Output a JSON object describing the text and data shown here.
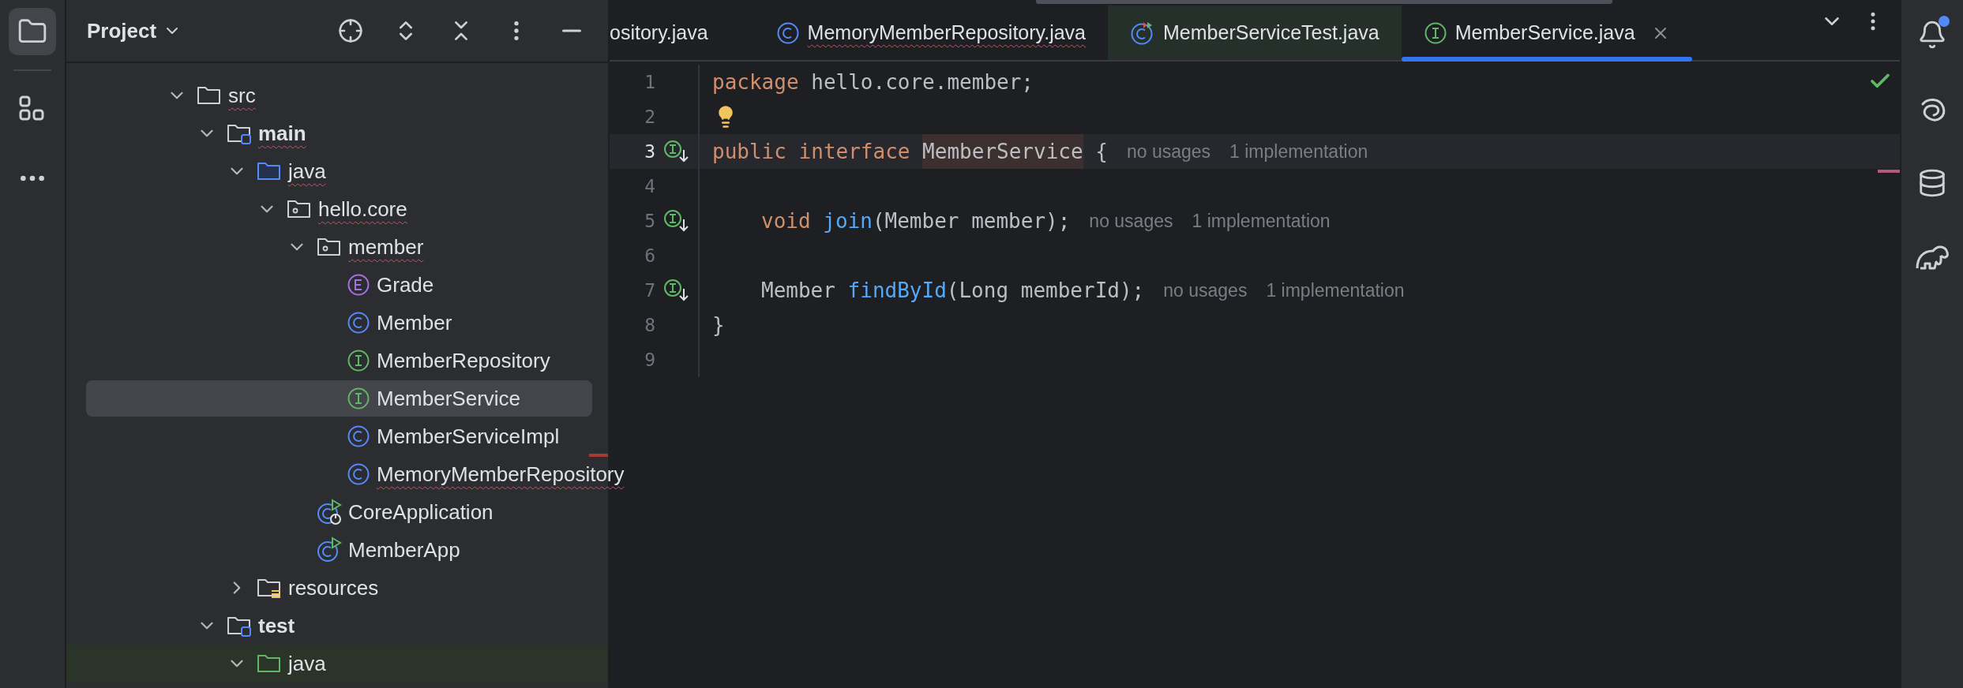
{
  "project_panel": {
    "title": "Project",
    "tree": [
      {
        "label": "src",
        "kind": "folder",
        "expanded": true,
        "error": true,
        "bold": false,
        "selected": false,
        "highlighted": false,
        "children": [
          {
            "label": "main",
            "kind": "source-root",
            "expanded": true,
            "error": true,
            "bold": true,
            "selected": false,
            "highlighted": false,
            "children": [
              {
                "label": "java",
                "kind": "source-folder",
                "expanded": true,
                "error": true,
                "bold": false,
                "selected": false,
                "highlighted": false,
                "children": [
                  {
                    "label": "hello.core",
                    "kind": "package",
                    "expanded": true,
                    "error": true,
                    "bold": false,
                    "selected": false,
                    "highlighted": false,
                    "children": [
                      {
                        "label": "member",
                        "kind": "package",
                        "expanded": true,
                        "error": true,
                        "bold": false,
                        "selected": false,
                        "highlighted": false,
                        "children": [
                          {
                            "label": "Grade",
                            "kind": "enum",
                            "error": false,
                            "bold": false,
                            "selected": false,
                            "highlighted": false
                          },
                          {
                            "label": "Member",
                            "kind": "class",
                            "error": false,
                            "bold": false,
                            "selected": false,
                            "highlighted": false
                          },
                          {
                            "label": "MemberRepository",
                            "kind": "interface",
                            "error": false,
                            "bold": false,
                            "selected": false,
                            "highlighted": false
                          },
                          {
                            "label": "MemberService",
                            "kind": "interface",
                            "error": false,
                            "bold": false,
                            "selected": true,
                            "highlighted": false
                          },
                          {
                            "label": "MemberServiceImpl",
                            "kind": "class",
                            "error": false,
                            "bold": false,
                            "selected": false,
                            "highlighted": false
                          },
                          {
                            "label": "MemoryMemberRepository",
                            "kind": "class",
                            "error": true,
                            "bold": false,
                            "selected": false,
                            "highlighted": false
                          }
                        ]
                      },
                      {
                        "label": "CoreApplication",
                        "kind": "spring-app",
                        "error": false,
                        "bold": false,
                        "selected": false,
                        "highlighted": false
                      },
                      {
                        "label": "MemberApp",
                        "kind": "app",
                        "error": false,
                        "bold": false,
                        "selected": false,
                        "highlighted": false
                      }
                    ]
                  }
                ]
              },
              {
                "label": "resources",
                "kind": "resources",
                "expanded": false,
                "error": false,
                "bold": false,
                "selected": false,
                "highlighted": false
              }
            ]
          },
          {
            "label": "test",
            "kind": "source-root",
            "expanded": true,
            "error": false,
            "bold": true,
            "selected": false,
            "highlighted": false,
            "children": [
              {
                "label": "java",
                "kind": "test-folder",
                "expanded": true,
                "error": false,
                "bold": false,
                "selected": false,
                "highlighted": true
              }
            ]
          }
        ]
      }
    ]
  },
  "tabs": [
    {
      "label": "ository.java",
      "kind": "none",
      "selected": false,
      "error": false,
      "highlighted": false
    },
    {
      "label": "MemoryMemberRepository.java",
      "kind": "class",
      "selected": false,
      "error": true,
      "highlighted": false
    },
    {
      "label": "MemberServiceTest.java",
      "kind": "test",
      "selected": false,
      "error": false,
      "highlighted": true
    },
    {
      "label": "MemberService.java",
      "kind": "interface",
      "selected": true,
      "error": false,
      "highlighted": false
    }
  ],
  "editor": {
    "lines": [
      {
        "number": "1",
        "current": false,
        "gutter_marker": false,
        "bulb": false,
        "indented": false,
        "tokens": [
          {
            "kind": "keyword",
            "text": "package"
          },
          {
            "kind": "plain",
            "text": " hello.core.member;"
          }
        ]
      },
      {
        "number": "2",
        "current": false,
        "gutter_marker": false,
        "bulb": true
      },
      {
        "number": "3",
        "current": true,
        "gutter_marker": true,
        "bulb": false,
        "indented": false,
        "tokens": [
          {
            "kind": "keyword",
            "text": "public interface "
          },
          {
            "kind": "highlight",
            "text": "MemberService"
          },
          {
            "kind": "plain",
            "text": " {"
          }
        ],
        "hints": [
          "no usages",
          "1 implementation"
        ]
      },
      {
        "number": "4",
        "current": false,
        "gutter_marker": false,
        "bulb": false
      },
      {
        "number": "5",
        "current": false,
        "gutter_marker": true,
        "bulb": false,
        "indented": true,
        "tokens": [
          {
            "kind": "keyword",
            "text": "void "
          },
          {
            "kind": "function",
            "text": "join"
          },
          {
            "kind": "plain",
            "text": "(Member member);"
          }
        ],
        "hints": [
          "no usages",
          "1 implementation"
        ]
      },
      {
        "number": "6",
        "current": false,
        "gutter_marker": false,
        "bulb": false
      },
      {
        "number": "7",
        "current": false,
        "gutter_marker": true,
        "bulb": false,
        "indented": true,
        "tokens": [
          {
            "kind": "plain",
            "text": "Member "
          },
          {
            "kind": "function",
            "text": "findById"
          },
          {
            "kind": "plain",
            "text": "(Long memberId);"
          }
        ],
        "hints": [
          "no usages",
          "1 implementation"
        ]
      },
      {
        "number": "8",
        "current": false,
        "gutter_marker": false,
        "bulb": false,
        "indented": false,
        "tokens": [
          {
            "kind": "plain",
            "text": "}"
          }
        ]
      },
      {
        "number": "9",
        "current": false,
        "gutter_marker": false,
        "bulb": false
      }
    ]
  },
  "notifications": {
    "unread": true
  }
}
